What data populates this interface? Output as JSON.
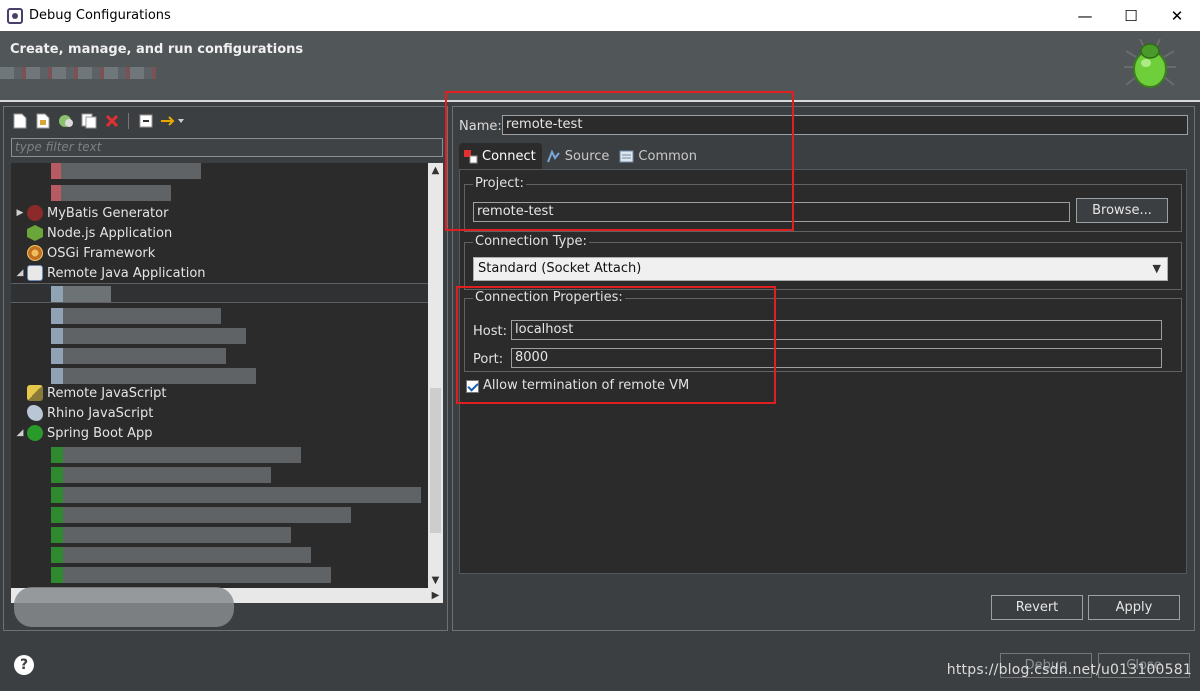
{
  "window": {
    "title": "Debug Configurations",
    "controls": [
      "—",
      "☐",
      "✕"
    ]
  },
  "header": {
    "subtitle": "Create, manage, and run configurations"
  },
  "left": {
    "filter_placeholder": "type filter text",
    "tree": [
      {
        "label": "MyBatis Generator",
        "icon": "mybatis-icon",
        "expander": "▶"
      },
      {
        "label": "Node.js Application",
        "icon": "nodejs-icon",
        "expander": ""
      },
      {
        "label": "OSGi Framework",
        "icon": "osgi-icon",
        "expander": ""
      },
      {
        "label": "Remote Java Application",
        "icon": "remote-java-icon",
        "expander": "◢"
      },
      {
        "label": "Remote JavaScript",
        "icon": "remote-javascript-icon",
        "expander": ""
      },
      {
        "label": "Rhino JavaScript",
        "icon": "rhino-icon",
        "expander": ""
      },
      {
        "label": "Spring Boot App",
        "icon": "spring-boot-icon",
        "expander": "◢"
      }
    ]
  },
  "right": {
    "name_label": "Name:",
    "name_value": "remote-test",
    "tabs": [
      {
        "label": "Connect",
        "icon": "connect-icon",
        "active": true
      },
      {
        "label": "Source",
        "icon": "source-icon",
        "active": false
      },
      {
        "label": "Common",
        "icon": "common-icon",
        "active": false
      }
    ],
    "project": {
      "title": "Project:",
      "value": "remote-test",
      "browse_label": "Browse..."
    },
    "connection_type": {
      "title": "Connection Type:",
      "value": "Standard (Socket Attach)"
    },
    "connection_properties": {
      "title": "Connection Properties:",
      "host_label": "Host:",
      "host_value": "localhost",
      "port_label": "Port:",
      "port_value": "8000"
    },
    "allow_termination": {
      "label": "Allow termination of remote VM",
      "checked": true
    },
    "revert_label": "Revert",
    "apply_label": "Apply"
  },
  "footer": {
    "help": "?",
    "debug_label": "Debug",
    "close_label": "Close",
    "watermark": "https://blog.csdn.net/u013100581"
  },
  "colors": {
    "background": "#3c3f41",
    "editor_bg": "#2b2b2b",
    "highlight_box": "#e02020"
  }
}
